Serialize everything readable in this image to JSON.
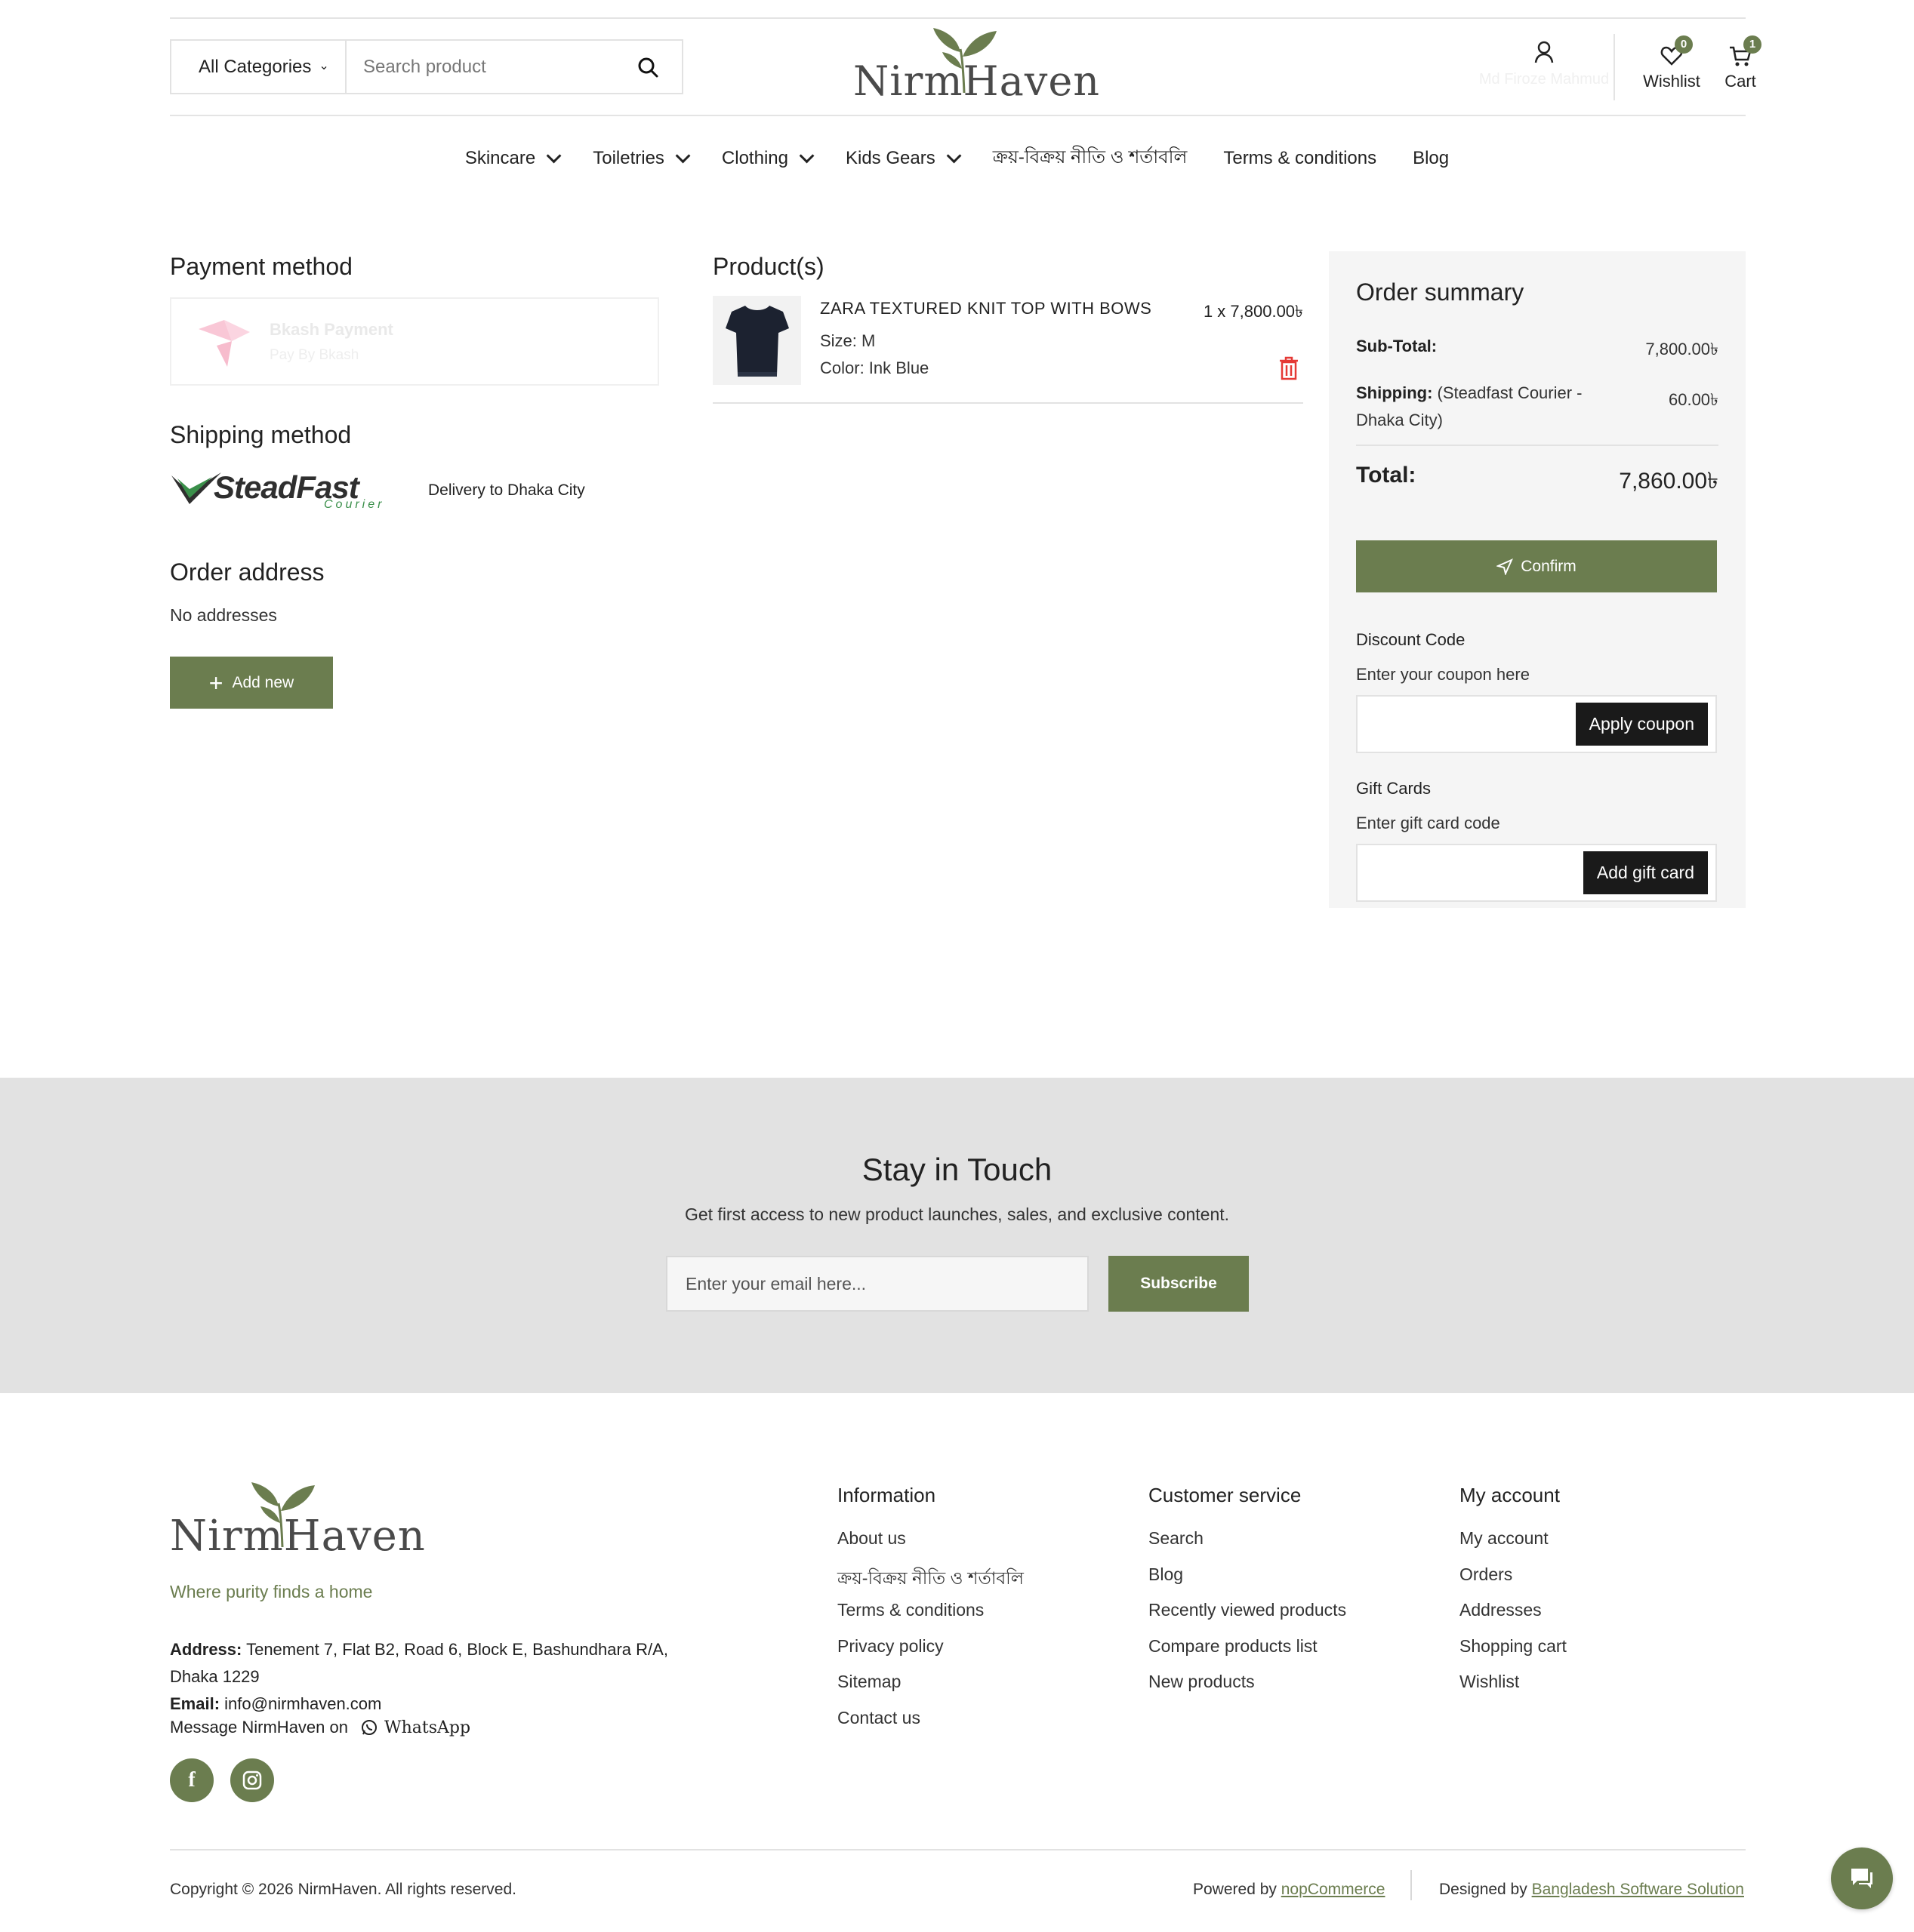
{
  "header": {
    "category_select": "All Categories",
    "search_placeholder": "Search product",
    "logo_text": "NirmHaven",
    "account_name": "Md Firoze Mahmud",
    "wishlist_label": "Wishlist",
    "wishlist_count": "0",
    "cart_label": "Cart",
    "cart_count": "1"
  },
  "nav": {
    "items": [
      {
        "label": "Skincare"
      },
      {
        "label": "Toiletries"
      },
      {
        "label": "Clothing"
      },
      {
        "label": "Kids Gears"
      },
      {
        "label": "ক্রয়-বিক্রয় নীতি ও শর্তাবলি"
      },
      {
        "label": "Terms & conditions"
      },
      {
        "label": "Blog"
      }
    ]
  },
  "payment": {
    "title": "Payment method",
    "method_name": "Bkash Payment",
    "method_desc": "Pay By Bkash"
  },
  "shipping": {
    "title": "Shipping method",
    "brand_main": "SteadFast",
    "brand_sub": "Courier",
    "desc": "Delivery to Dhaka City"
  },
  "address": {
    "title": "Order address",
    "empty_text": "No addresses",
    "add_new_label": "Add new"
  },
  "products": {
    "title": "Product(s)",
    "items": [
      {
        "name": "ZARA TEXTURED KNIT TOP WITH BOWS",
        "size": "Size: M",
        "color": "Color: Ink Blue",
        "qty_price": "1  x  7,800.00৳"
      }
    ]
  },
  "summary": {
    "title": "Order summary",
    "subtotal_label": "Sub-Total:",
    "subtotal_value": "7,800.00৳",
    "shipping_label": "Shipping:",
    "shipping_detail": "(Steadfast Courier - Dhaka City)",
    "shipping_value": "60.00৳",
    "total_label": "Total:",
    "total_value": "7,860.00৳",
    "confirm_label": "Confirm",
    "discount_title": "Discount Code",
    "discount_hint": "Enter your coupon here",
    "apply_coupon_label": "Apply coupon",
    "gift_title": "Gift Cards",
    "gift_hint": "Enter gift card code",
    "add_gift_label": "Add gift card"
  },
  "newsletter": {
    "title": "Stay in Touch",
    "subtitle": "Get first access to new product launches, sales, and exclusive content.",
    "email_placeholder": "Enter your email here...",
    "subscribe_label": "Subscribe"
  },
  "footer": {
    "logo_text": "NirmHaven",
    "tagline": "Where purity finds a home",
    "address_label": "Address:",
    "address_value": "Tenement 7, Flat B2, Road 6, Block E, Bashundhara R/A, Dhaka 1229",
    "email_label": "Email:",
    "email_value": "info@nirmhaven.com",
    "message_text": "Message NirmHaven on",
    "whatsapp_label": "WhatsApp",
    "social": [
      "facebook-icon",
      "instagram-icon"
    ],
    "columns": [
      {
        "title": "Information",
        "items": [
          "About us",
          "ক্রয়-বিক্রয় নীতি ও শর্তাবলি",
          "Terms & conditions",
          "Privacy policy",
          "Sitemap",
          "Contact us"
        ]
      },
      {
        "title": "Customer service",
        "items": [
          "Search",
          "Blog",
          "Recently viewed products",
          "Compare products list",
          "New products"
        ]
      },
      {
        "title": "My account",
        "items": [
          "My account",
          "Orders",
          "Addresses",
          "Shopping cart",
          "Wishlist"
        ]
      }
    ],
    "copyright": "Copyright © 2026 NirmHaven. All rights reserved.",
    "powered_prefix": "Powered by",
    "powered_link": "nopCommerce",
    "designed_prefix": "Designed by",
    "designed_link": "Bangladesh Software Solution"
  },
  "colors": {
    "brand_green": "#6b7d4f",
    "dark_button": "#1a1a1a",
    "newsletter_bg": "#e2e2e2",
    "summary_bg": "#f5f5f5",
    "trash_red": "#e53935"
  }
}
